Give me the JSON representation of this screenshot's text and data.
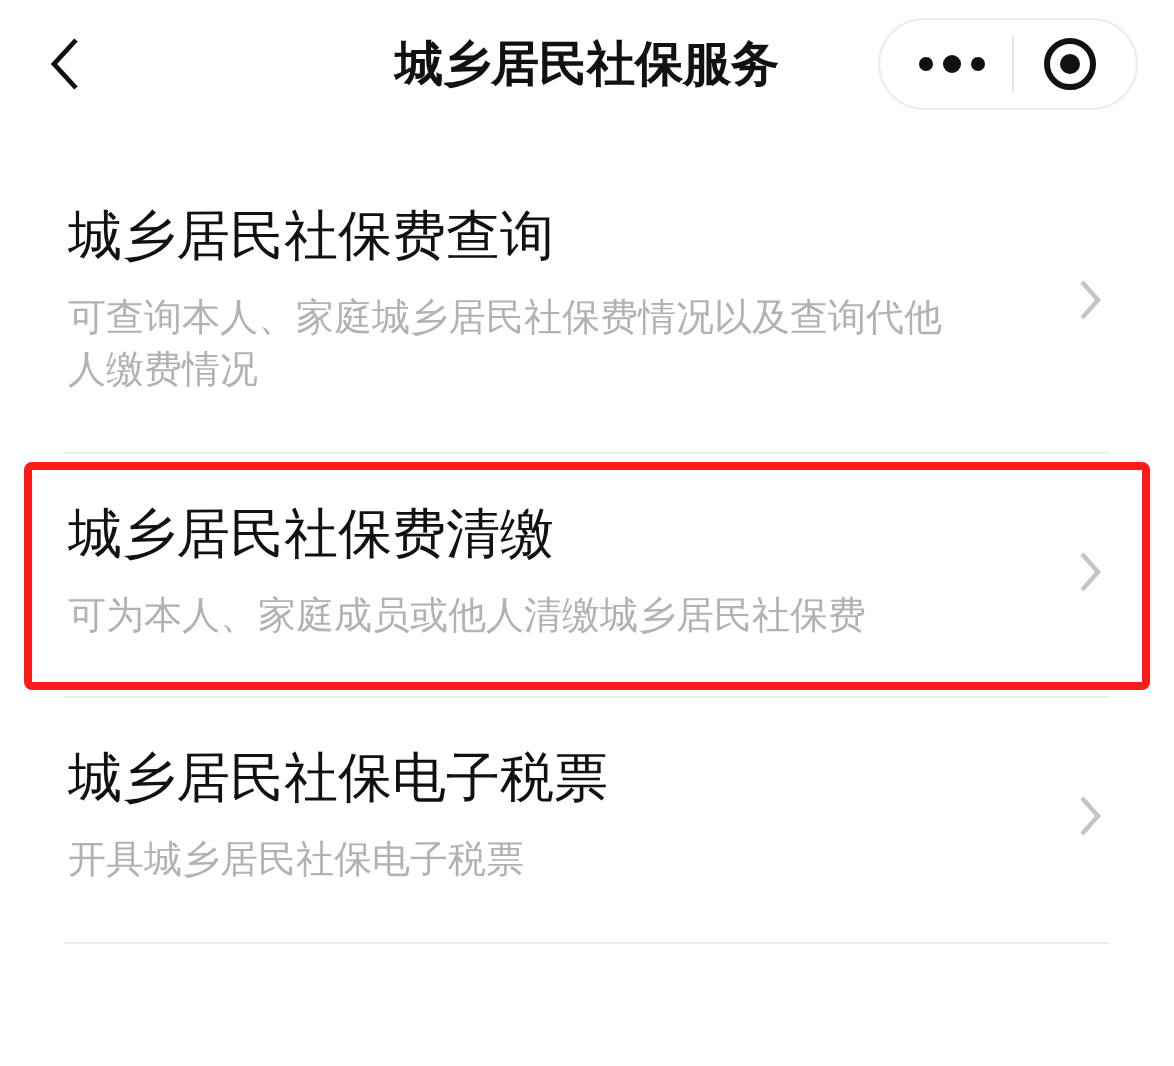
{
  "header": {
    "title": "城乡居民社保服务"
  },
  "items": [
    {
      "title": "城乡居民社保费查询",
      "description": "可查询本人、家庭城乡居民社保费情况以及查询代他人缴费情况",
      "highlighted": false
    },
    {
      "title": "城乡居民社保费清缴",
      "description": "可为本人、家庭成员或他人清缴城乡居民社保费",
      "highlighted": true
    },
    {
      "title": "城乡居民社保电子税票",
      "description": "开具城乡居民社保电子税票",
      "highlighted": false
    }
  ]
}
